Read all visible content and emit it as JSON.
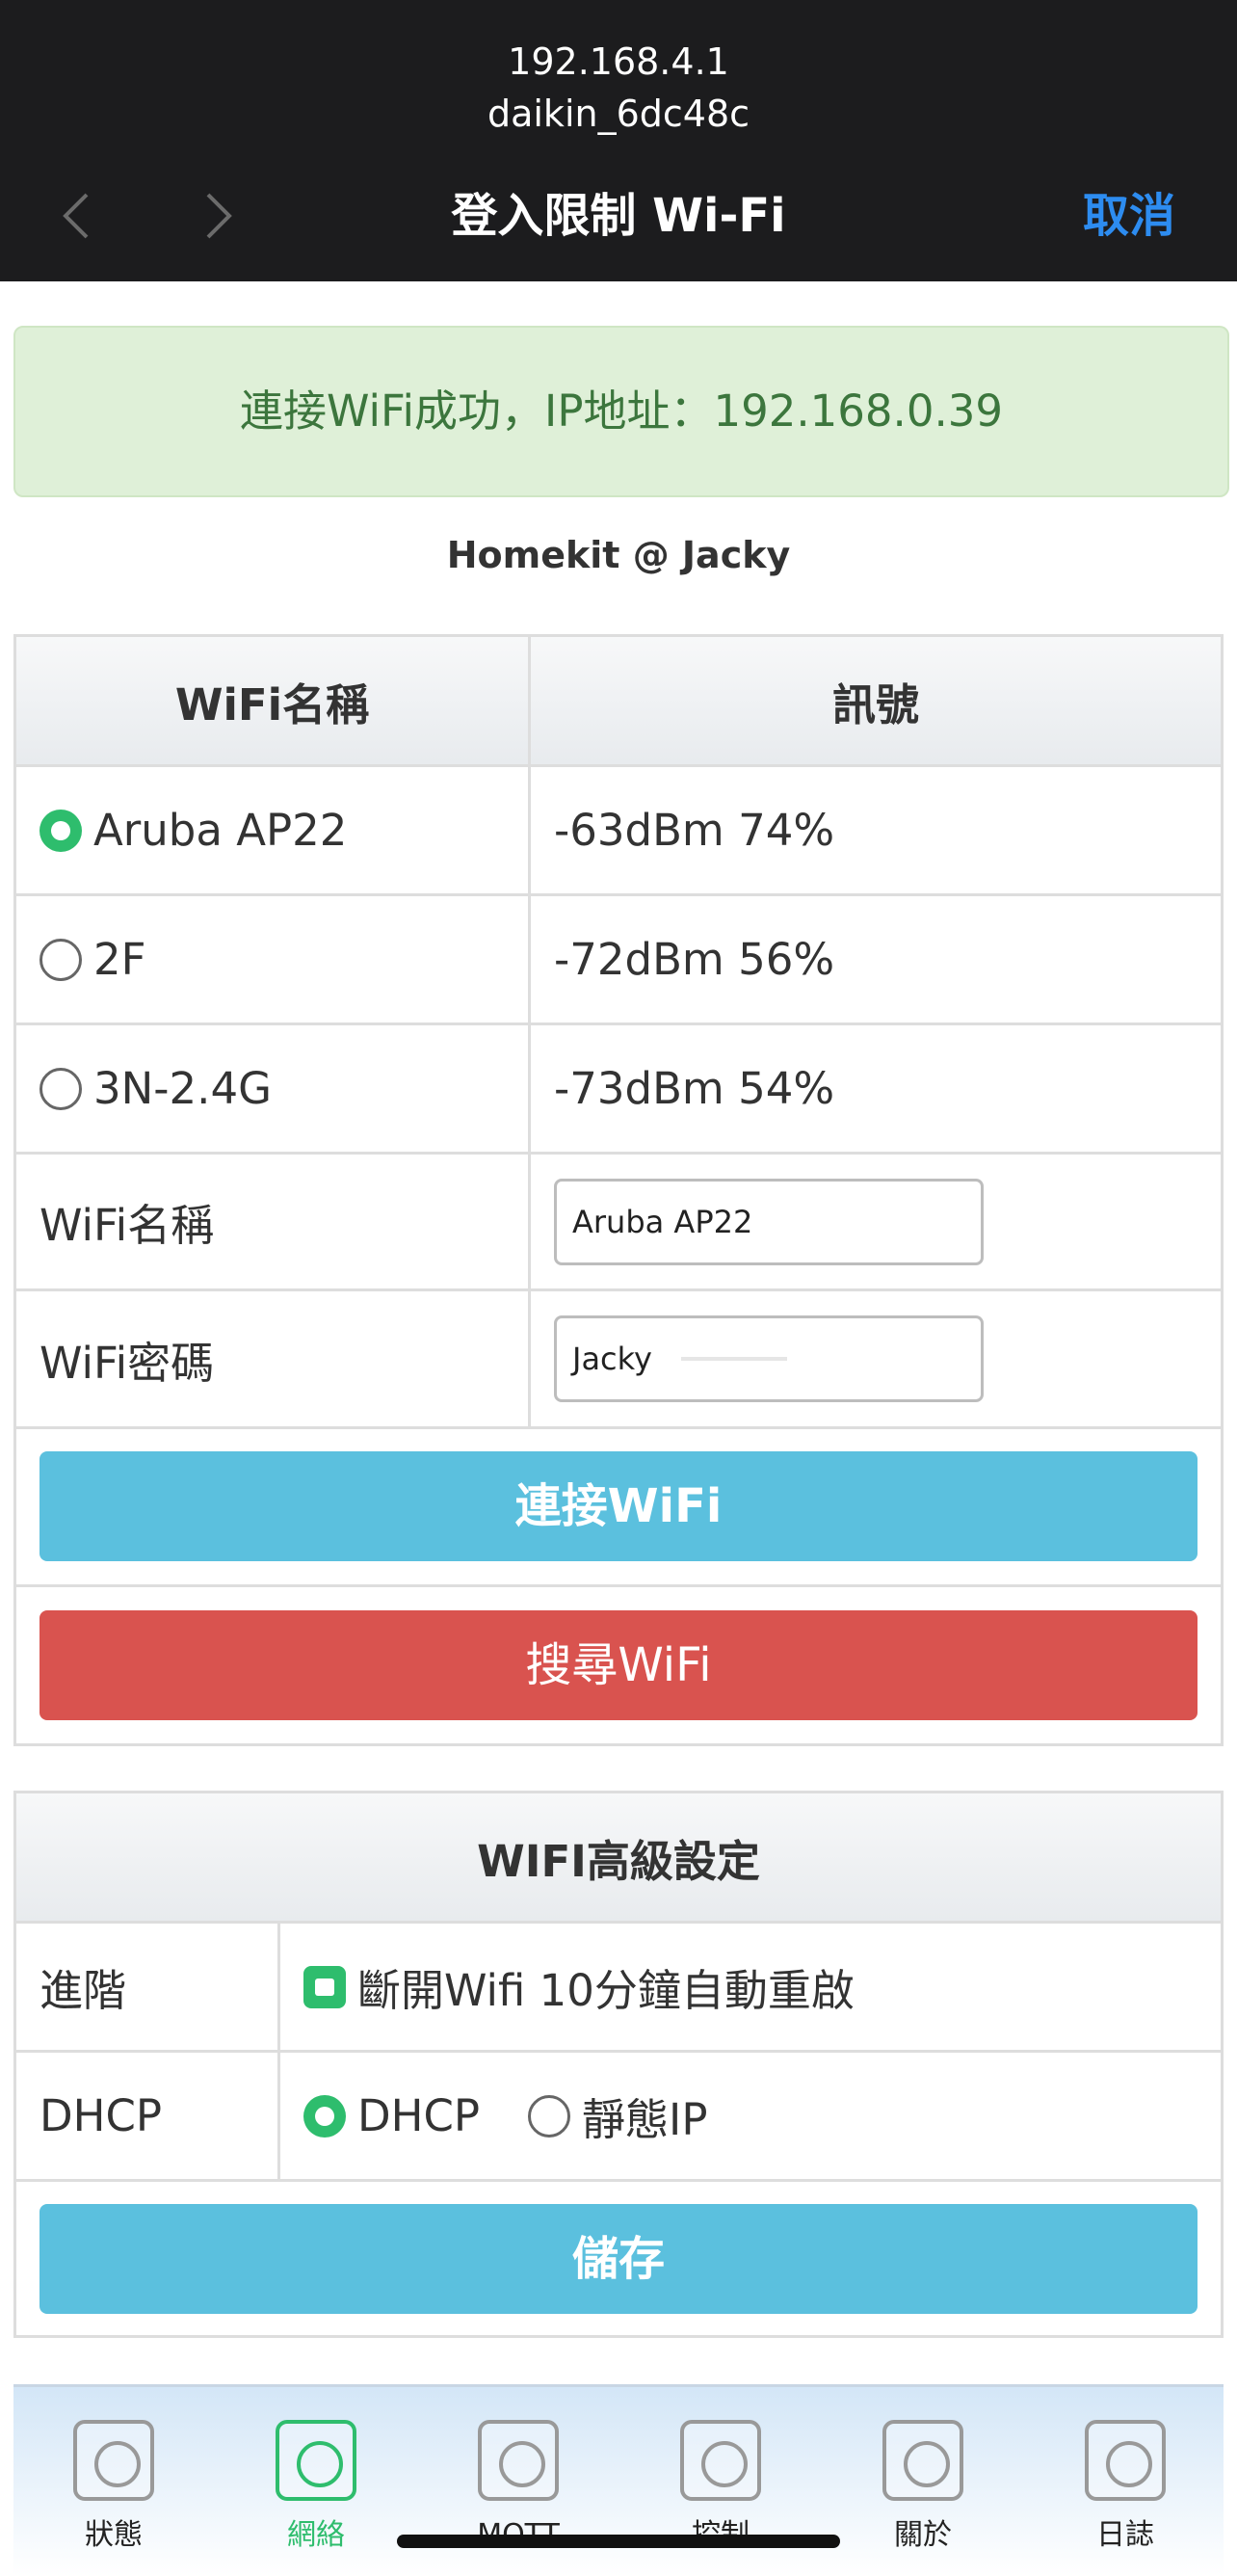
{
  "browser": {
    "host": "192.168.4.1",
    "ssid": "daikin_6dc48c",
    "title": "登入限制 Wi-Fi",
    "cancel_label": "取消",
    "back_icon": "chevron-left-icon",
    "forward_icon": "chevron-right-icon"
  },
  "alert": {
    "text": "連接WiFi成功，IP地址：192.168.0.39",
    "color": "#3c763d"
  },
  "page": {
    "heading": "Homekit @ Jacky"
  },
  "wifi_table": {
    "headers": [
      "WiFi名稱",
      "訊號"
    ],
    "networks": [
      {
        "name": "Aruba AP22",
        "signal": "-63dBm 74%",
        "selected": true
      },
      {
        "name": "2F",
        "signal": "-72dBm 56%",
        "selected": false
      },
      {
        "name": "3N-2.4G",
        "signal": "-73dBm 54%",
        "selected": false
      }
    ],
    "ssid_label": "WiFi名稱",
    "ssid_value": "Aruba AP22",
    "password_label": "WiFi密碼",
    "password_value": "Jacky",
    "connect_label": "連接WiFi",
    "scan_label": "搜尋WiFi"
  },
  "advanced": {
    "title": "WIFI高級設定",
    "advanced_label": "進階",
    "auto_restart_label": "斷開Wifi 10分鐘自動重啟",
    "auto_restart_checked": true,
    "dhcp_label": "DHCP",
    "dhcp_option": "DHCP",
    "static_option": "靜態IP",
    "dhcp_selected": true,
    "save_label": "儲存"
  },
  "tabs": [
    {
      "label": "狀態",
      "active": false
    },
    {
      "label": "網絡",
      "active": true
    },
    {
      "label": "MQTT",
      "active": false
    },
    {
      "label": "控制",
      "active": false
    },
    {
      "label": "關於",
      "active": false
    },
    {
      "label": "日誌",
      "active": false
    }
  ],
  "colors": {
    "accent_green": "#2ebd6d",
    "info_blue": "#5bc0de",
    "danger_red": "#d9534f",
    "link_blue": "#2d8cf0"
  }
}
